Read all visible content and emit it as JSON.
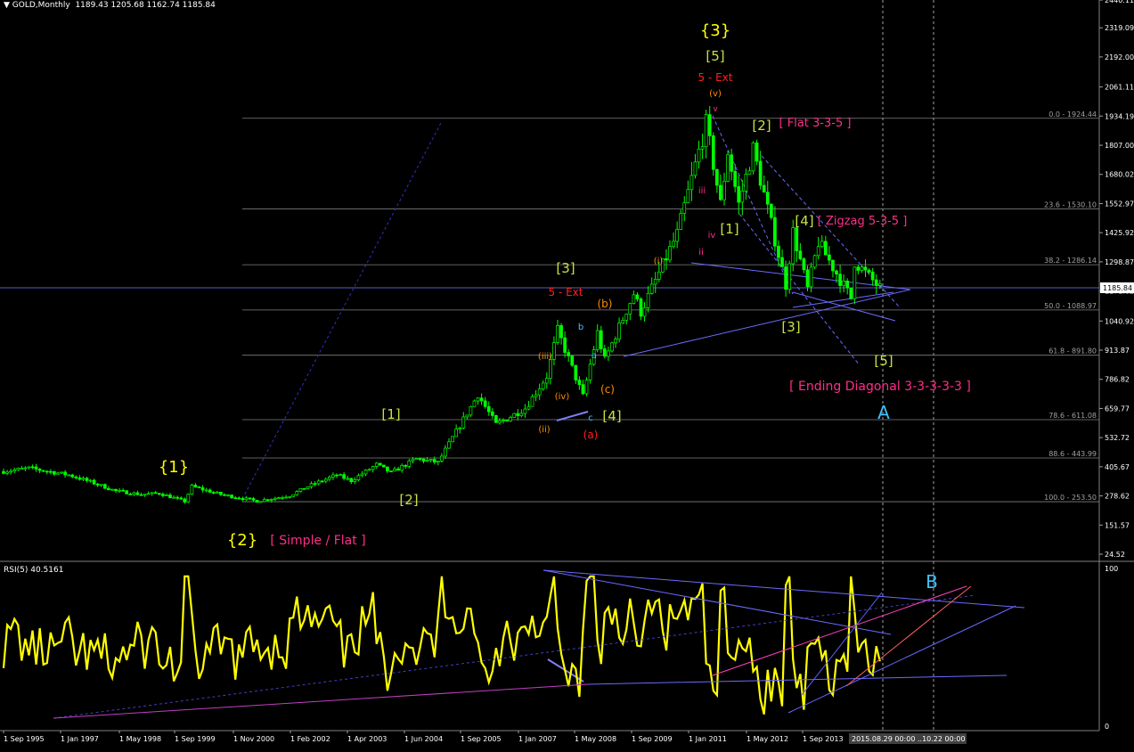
{
  "header": {
    "symbol": "GOLD,Monthly",
    "ohlc": "1189.43 1205.68 1162.74 1185.84"
  },
  "rsi_header": "RSI(5) 40.5161",
  "colors": {
    "background": "#000000",
    "candle": "#00ff00",
    "rsi_line": "#ffff00",
    "grid": "#808080",
    "fib": "#808080",
    "trendline": "#6a6aff",
    "label_yellow": "#ffff00",
    "label_green": "#c8e040",
    "label_red": "#ff2020",
    "label_orange": "#ff8c00",
    "label_pink": "#ff2e8a",
    "label_cyan": "#40c0ff"
  },
  "price_axis": {
    "ticks": [
      "2440.11",
      "2319.09",
      "2192.00",
      "2061.11",
      "1934.19",
      "1807.00",
      "1680.02",
      "1552.97",
      "1425.92",
      "1298.87",
      "1171.82",
      "1040.92",
      "913.87",
      "786.82",
      "659.77",
      "532.72",
      "405.67",
      "278.62",
      "151.57",
      "24.52"
    ],
    "current": "1185.84"
  },
  "rsi_axis": {
    "ticks": [
      "100",
      "0"
    ]
  },
  "time_axis": {
    "ticks": [
      "1 Sep 1995",
      "1 Jan 1997",
      "1 May 1998",
      "1 Sep 1999",
      "1 Nov 2000",
      "1 Feb 2002",
      "1 Apr 2003",
      "1 Jun 2004",
      "1 Sep 2005",
      "1 Jan 2007",
      "1 May 2008",
      "1 Sep 2009",
      "1 Jan 2011",
      "1 May 2012",
      "1 Sep 2013"
    ],
    "cursor_label": "2015.08.29 00:00",
    "cursor_label2": "..10.22 00:00"
  },
  "fib_levels": [
    {
      "label": "0.0 - 1924.44"
    },
    {
      "label": "23.6 - 1530.10"
    },
    {
      "label": "38.2 - 1286.14"
    },
    {
      "label": "50.0 - 1088.97"
    },
    {
      "label": "61.8 - 891.80"
    },
    {
      "label": "78.6 - 611.08"
    },
    {
      "label": "88.6 - 443.99"
    },
    {
      "label": "100.0 - 253.50"
    }
  ],
  "wave_labels": [
    {
      "t": "{1}",
      "c": "label_yellow"
    },
    {
      "t": "{2}",
      "c": "label_yellow"
    },
    {
      "t": "[ Simple / Flat ]",
      "c": "label_pink"
    },
    {
      "t": "{3}",
      "c": "label_yellow"
    },
    {
      "t": "[5]",
      "c": "label_green"
    },
    {
      "t": "5 - Ext",
      "c": "label_red"
    },
    {
      "t": "(v)",
      "c": "label_orange"
    },
    {
      "t": "v",
      "c": "label_pink"
    },
    {
      "t": "[2]",
      "c": "label_green"
    },
    {
      "t": "[ Flat 3-3-5 ]",
      "c": "label_pink"
    },
    {
      "t": "[4]",
      "c": "label_green"
    },
    {
      "t": "[ Zigzag 5-3-5 ]",
      "c": "label_pink"
    },
    {
      "t": "[1]",
      "c": "label_green"
    },
    {
      "t": "[3]",
      "c": "label_green"
    },
    {
      "t": "[5]",
      "c": "label_green"
    },
    {
      "t": "[ Ending Diagonal 3-3-3-3-3 ]",
      "c": "label_pink"
    },
    {
      "t": "[1]",
      "c": "label_green"
    },
    {
      "t": "[2]",
      "c": "label_green"
    },
    {
      "t": "[3]",
      "c": "label_green"
    },
    {
      "t": "5 - Ext",
      "c": "label_red"
    },
    {
      "t": "[4]",
      "c": "label_green"
    },
    {
      "t": "(a)",
      "c": "label_red"
    },
    {
      "t": "(b)",
      "c": "label_orange"
    },
    {
      "t": "(c)",
      "c": "label_orange"
    },
    {
      "t": "a",
      "c": "label_cyan"
    },
    {
      "t": "b",
      "c": "label_cyan"
    },
    {
      "t": "c",
      "c": "label_cyan"
    },
    {
      "t": "iii",
      "c": "label_pink"
    },
    {
      "t": "iv",
      "c": "label_pink"
    },
    {
      "t": "ii",
      "c": "label_pink"
    },
    {
      "t": "(iii)",
      "c": "label_orange"
    },
    {
      "t": "(iv)",
      "c": "label_orange"
    },
    {
      "t": "(ii)",
      "c": "label_orange"
    },
    {
      "t": "(i)",
      "c": "label_orange"
    }
  ],
  "chart_data": {
    "type": "candlestick",
    "title": "GOLD,Monthly",
    "x_range": [
      "1995-06",
      "2015-11"
    ],
    "ylim": [
      24.52,
      2440.11
    ],
    "price_path": [
      [
        "1995-06",
        385
      ],
      [
        "1996-01",
        400
      ],
      [
        "1996-12",
        370
      ],
      [
        "1997-06",
        340
      ],
      [
        "1998-01",
        300
      ],
      [
        "1998-08",
        285
      ],
      [
        "1999-01",
        290
      ],
      [
        "1999-08",
        255
      ],
      [
        "1999-10",
        320
      ],
      [
        "2000-06",
        285
      ],
      [
        "2001-04",
        256
      ],
      [
        "2002-01",
        280
      ],
      [
        "2002-06",
        320
      ],
      [
        "2003-02",
        370
      ],
      [
        "2003-06",
        345
      ],
      [
        "2004-01",
        415
      ],
      [
        "2004-05",
        380
      ],
      [
        "2004-12",
        440
      ],
      [
        "2005-06",
        425
      ],
      [
        "2006-05",
        720
      ],
      [
        "2006-10",
        590
      ],
      [
        "2007-06",
        660
      ],
      [
        "2007-12",
        800
      ],
      [
        "2008-03",
        1000
      ],
      [
        "2008-10",
        712
      ],
      [
        "2009-02",
        990
      ],
      [
        "2009-04",
        870
      ],
      [
        "2009-12",
        1160
      ],
      [
        "2010-02",
        1080
      ],
      [
        "2010-12",
        1420
      ],
      [
        "2011-08",
        1900
      ],
      [
        "2011-12",
        1550
      ],
      [
        "2012-02",
        1780
      ],
      [
        "2012-05",
        1550
      ],
      [
        "2012-09",
        1790
      ],
      [
        "2013-06",
        1200
      ],
      [
        "2013-08",
        1430
      ],
      [
        "2013-12",
        1180
      ],
      [
        "2014-03",
        1385
      ],
      [
        "2014-12",
        1140
      ],
      [
        "2015-01",
        1300
      ],
      [
        "2015-08",
        1185
      ]
    ],
    "rsi_series": {
      "name": "RSI(5)",
      "last": 40.5161,
      "ylim": [
        0,
        100
      ]
    }
  }
}
